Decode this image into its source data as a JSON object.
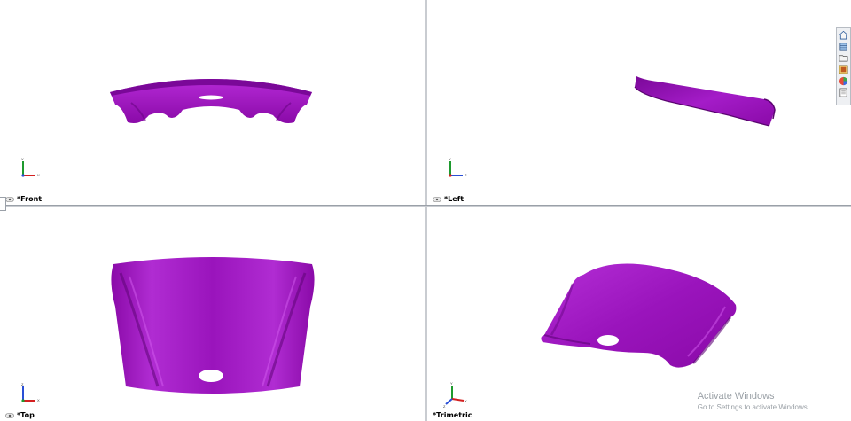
{
  "viewports": {
    "front": {
      "label": "*Front"
    },
    "left": {
      "label": "*Left"
    },
    "top": {
      "label": "*Top"
    },
    "trimetric": {
      "label": "*Trimetric"
    }
  },
  "triad": {
    "front": {
      "x": "X",
      "y": "Y"
    },
    "left": {
      "z": "Z",
      "y": "Y"
    },
    "top": {
      "x": "X",
      "z": "Z"
    },
    "trimetric": {
      "x": "X",
      "y": "Y",
      "z": "Z"
    }
  },
  "toolbar": {
    "icons": [
      "zoom-to-fit-icon",
      "zoom-to-area-icon",
      "previous-view-icon",
      "section-view-icon",
      "dynamic-annotation-icon",
      "view-orientation-icon",
      "display-style-icon",
      "hide-show-items-icon",
      "edit-appearance-icon",
      "apply-scene-icon",
      "view-settings-icon"
    ]
  },
  "taskpane": {
    "icons": [
      "home-icon",
      "design-library-icon",
      "file-explorer-icon",
      "view-palette-icon",
      "appearances-icon",
      "custom-properties-icon"
    ]
  },
  "watermark": {
    "title": "Activate Windows",
    "subtitle": "Go to Settings to activate Windows."
  },
  "colors": {
    "part": "#9a0fbf",
    "part_dark": "#6a0585",
    "part_light": "#c23ee0",
    "background": "#ffffff"
  }
}
